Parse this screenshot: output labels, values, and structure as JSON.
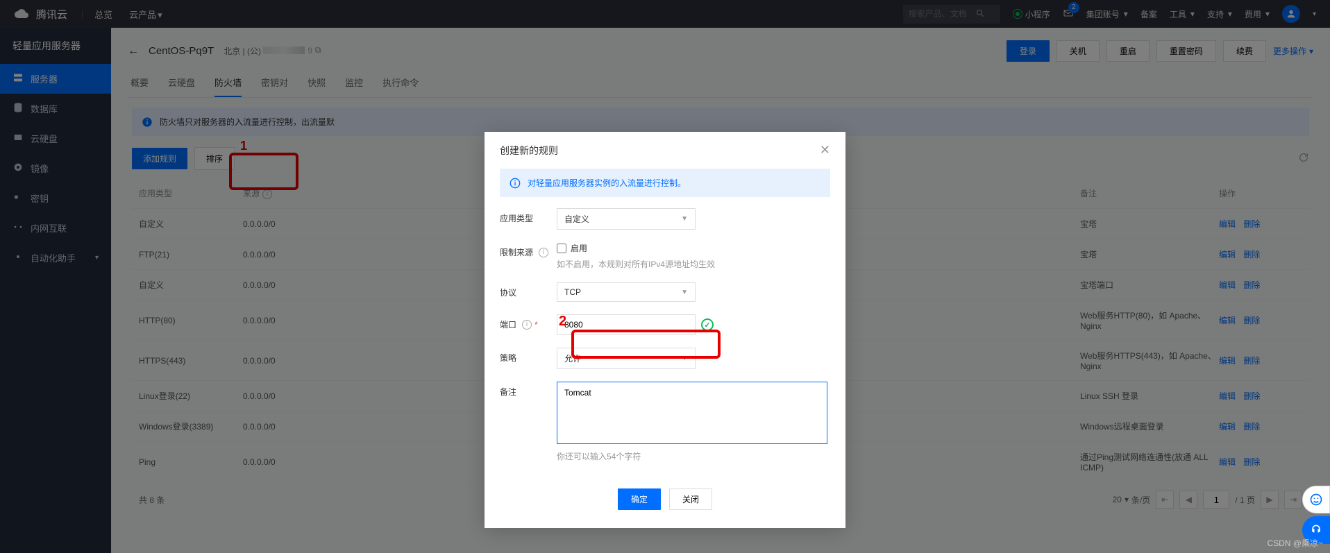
{
  "annot": {
    "one": "1",
    "two": "2"
  },
  "header": {
    "brand": "腾讯云",
    "overview": "总览",
    "cloud_products": "云产品",
    "search_placeholder": "搜索产品、文档",
    "mini_program": "小程序",
    "msg_badge": "2",
    "group_account": "集团账号",
    "filing": "备案",
    "tools": "工具",
    "support": "支持",
    "cost": "费用"
  },
  "sidebar": {
    "title": "轻量应用服务器",
    "items": [
      {
        "label": "服务器"
      },
      {
        "label": "数据库"
      },
      {
        "label": "云硬盘"
      },
      {
        "label": "镜像"
      },
      {
        "label": "密钥"
      },
      {
        "label": "内网互联"
      },
      {
        "label": "自动化助手"
      }
    ]
  },
  "page": {
    "title": "CentOS-Pq9T",
    "region_label": "北京 | (公)",
    "ip_suffix": "9",
    "copy": "⧉",
    "login": "登录",
    "shutdown": "关机",
    "restart": "重启",
    "reset_pwd": "重置密码",
    "renew": "续费",
    "more": "更多操作"
  },
  "tabs": {
    "overview": "概要",
    "cloud_disk": "云硬盘",
    "firewall": "防火墙",
    "keypair": "密钥对",
    "snapshot": "快照",
    "monitor": "监控",
    "exec": "执行命令"
  },
  "banner": "防火墙只对服务器的入流量进行控制，出流量默",
  "toolbar": {
    "add_rule": "添加规则",
    "sort": "排序"
  },
  "table": {
    "headers": {
      "app_type": "应用类型",
      "source": "来源",
      "notes": "备注",
      "actions": "操作"
    },
    "action_edit": "编辑",
    "action_delete": "删除",
    "rows": [
      {
        "type": "自定义",
        "source": "0.0.0.0/0",
        "note": "宝塔"
      },
      {
        "type": "FTP(21)",
        "source": "0.0.0.0/0",
        "note": "宝塔"
      },
      {
        "type": "自定义",
        "source": "0.0.0.0/0",
        "note": "宝塔端口"
      },
      {
        "type": "HTTP(80)",
        "source": "0.0.0.0/0",
        "note": "Web服务HTTP(80)，如 Apache、Nginx"
      },
      {
        "type": "HTTPS(443)",
        "source": "0.0.0.0/0",
        "note": "Web服务HTTPS(443)，如 Apache、Nginx"
      },
      {
        "type": "Linux登录(22)",
        "source": "0.0.0.0/0",
        "note": "Linux SSH 登录"
      },
      {
        "type": "Windows登录(3389)",
        "source": "0.0.0.0/0",
        "note": "Windows远程桌面登录"
      },
      {
        "type": "Ping",
        "source": "0.0.0.0/0",
        "note": "通过Ping测试网络连通性(放通 ALL ICMP)"
      }
    ]
  },
  "pagination": {
    "total": "共 8 条",
    "page_size": "20",
    "per_page_suffix": "条/页",
    "current": "1",
    "total_pages": "/ 1 页"
  },
  "modal": {
    "title": "创建新的规则",
    "info": "对轻量应用服务器实例的入流量进行控制。",
    "form": {
      "app_type": {
        "label": "应用类型",
        "value": "自定义"
      },
      "limit_source": {
        "label": "限制来源",
        "enable": "启用",
        "hint": "如不启用，本规则对所有IPv4源地址均生效"
      },
      "protocol": {
        "label": "协议",
        "value": "TCP"
      },
      "port": {
        "label": "端口",
        "value": "8080"
      },
      "policy": {
        "label": "策略",
        "value": "允许"
      },
      "remark": {
        "label": "备注",
        "value": "Tomcat",
        "hint": "你还可以输入54个字符"
      }
    },
    "confirm": "确定",
    "close": "关闭"
  },
  "watermark": "CSDN @乘凉~"
}
